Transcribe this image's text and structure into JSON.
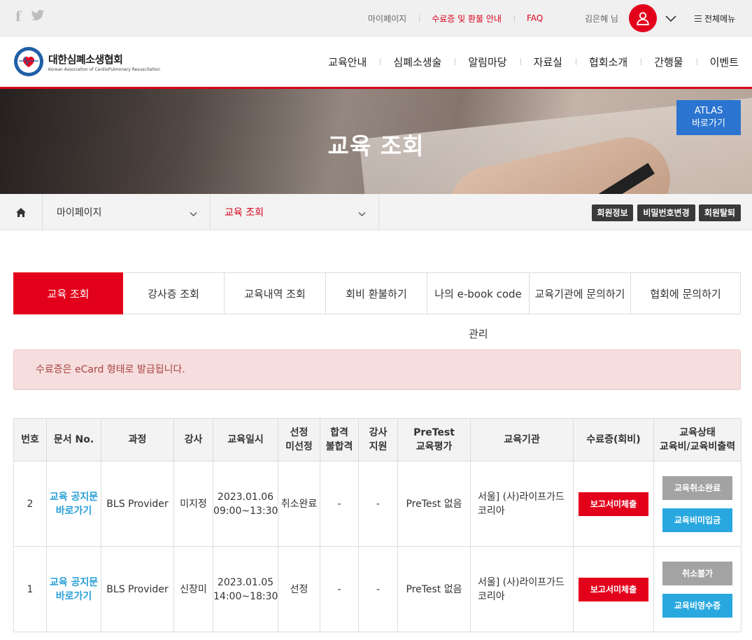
{
  "topbar": {
    "social": [
      {
        "icon": "facebook-icon",
        "glyph": "f"
      },
      {
        "icon": "twitter-icon",
        "glyph": "t"
      }
    ],
    "links": [
      {
        "label": "마이페이지",
        "highlight": false
      },
      {
        "label": "수료증 및 환불 안내",
        "highlight": true
      },
      {
        "label": "FAQ",
        "highlight": true
      }
    ],
    "username": "김은혜 님",
    "all_menu": "전체메뉴"
  },
  "header": {
    "logo_kor": "대한심폐소생협회",
    "logo_eng": "Korean Association of CardioPulmonary Resuscitation",
    "nav": [
      "교육안내",
      "심폐소생술",
      "알림마당",
      "자료실",
      "협회소개",
      "간행물",
      "이벤트"
    ]
  },
  "banner": {
    "title": "교육 조회",
    "atlas_line1": "ATLAS",
    "atlas_line2": "바로가기"
  },
  "location": {
    "depth1": "마이페이지",
    "depth2": "교육 조회",
    "buttons": [
      "회원정보",
      "비밀번호변경",
      "회원탈퇴"
    ]
  },
  "tabs": [
    "교육 조회",
    "강사증 조회",
    "교육내역 조회",
    "회비 환불하기",
    "나의 e-book code",
    "교육기관에 문의하기",
    "협회에 문의하기"
  ],
  "tab_extra": "관리",
  "alert": "수료증은 eCard 형태로 발급됩니다.",
  "table": {
    "headers": [
      [
        "번호"
      ],
      [
        "문서 No."
      ],
      [
        "과정"
      ],
      [
        "강사"
      ],
      [
        "교육일시"
      ],
      [
        "선정",
        "미선정"
      ],
      [
        "합격",
        "불합격"
      ],
      [
        "강사",
        "지원"
      ],
      [
        "PreTest",
        "교육평가"
      ],
      [
        "교육기관"
      ],
      [
        "수료증(회비)"
      ],
      [
        "교육상태",
        "교육비/교육비출력"
      ]
    ],
    "rows": [
      {
        "no": "2",
        "doc": [
          "교육 공지문",
          "바로가기"
        ],
        "course": "BLS Provider",
        "instructor": "미지정",
        "date": [
          "2023.01.06",
          "09:00~13:30"
        ],
        "selection": "취소완료",
        "pass": "-",
        "support": "-",
        "pretest": "PreTest 없음",
        "org": [
          "서울] (사)라이프가드",
          "코리아"
        ],
        "cert_btn": "보고서미체출",
        "status_btn1": "교육취소완료",
        "status_btn2": "교육비미입금"
      },
      {
        "no": "1",
        "doc": [
          "교육 공지문",
          "바로가기"
        ],
        "course": "BLS Provider",
        "instructor": "신장미",
        "date": [
          "2023.01.05",
          "14:00~18:30"
        ],
        "selection": "선정",
        "pass": "-",
        "support": "-",
        "pretest": "PreTest 없음",
        "org": [
          "서울] (사)라이프가드",
          "코리아"
        ],
        "cert_btn": "보고서미체출",
        "status_btn1": "취소불가",
        "status_btn2": "교육비영수증"
      }
    ]
  },
  "colors": {
    "brand_red": "#e3001b",
    "link_blue": "#2a9fd6",
    "atlas_blue": "#2b74cf"
  }
}
